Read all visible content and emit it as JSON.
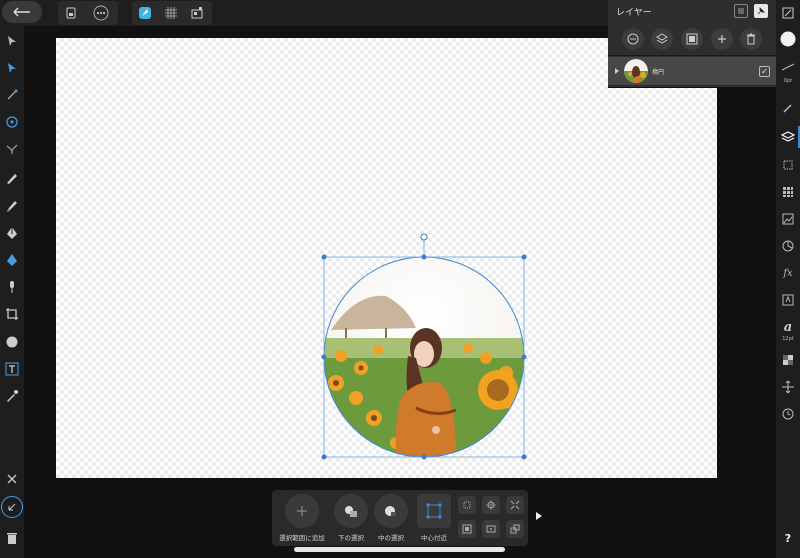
{
  "topbar": {
    "back_icon": "back-arrow-icon",
    "document_icon": "document-icon",
    "more_icon": "more-icon",
    "persona_icon": "designer-persona-icon",
    "grid_icon": "grid-icon",
    "export_icon": "export-persona-icon"
  },
  "layers_panel": {
    "title": "レイヤー",
    "layer_name": "楕円",
    "layer_checked": "✓"
  },
  "right_strip": {
    "stroke_width": "0pt",
    "font_size": "12pt",
    "help": "?"
  },
  "context_bar": {
    "add_to_selection": "選択範囲に追加",
    "select_below": "下の選択",
    "select_middle": "中の選択",
    "near_center": "中心付近",
    "add_icon": "plus-icon"
  },
  "colors": {
    "accent": "#3a8bd6",
    "handle": "#3a7bd5",
    "panel": "#2e2e2e",
    "background": "#1e1e1e"
  }
}
